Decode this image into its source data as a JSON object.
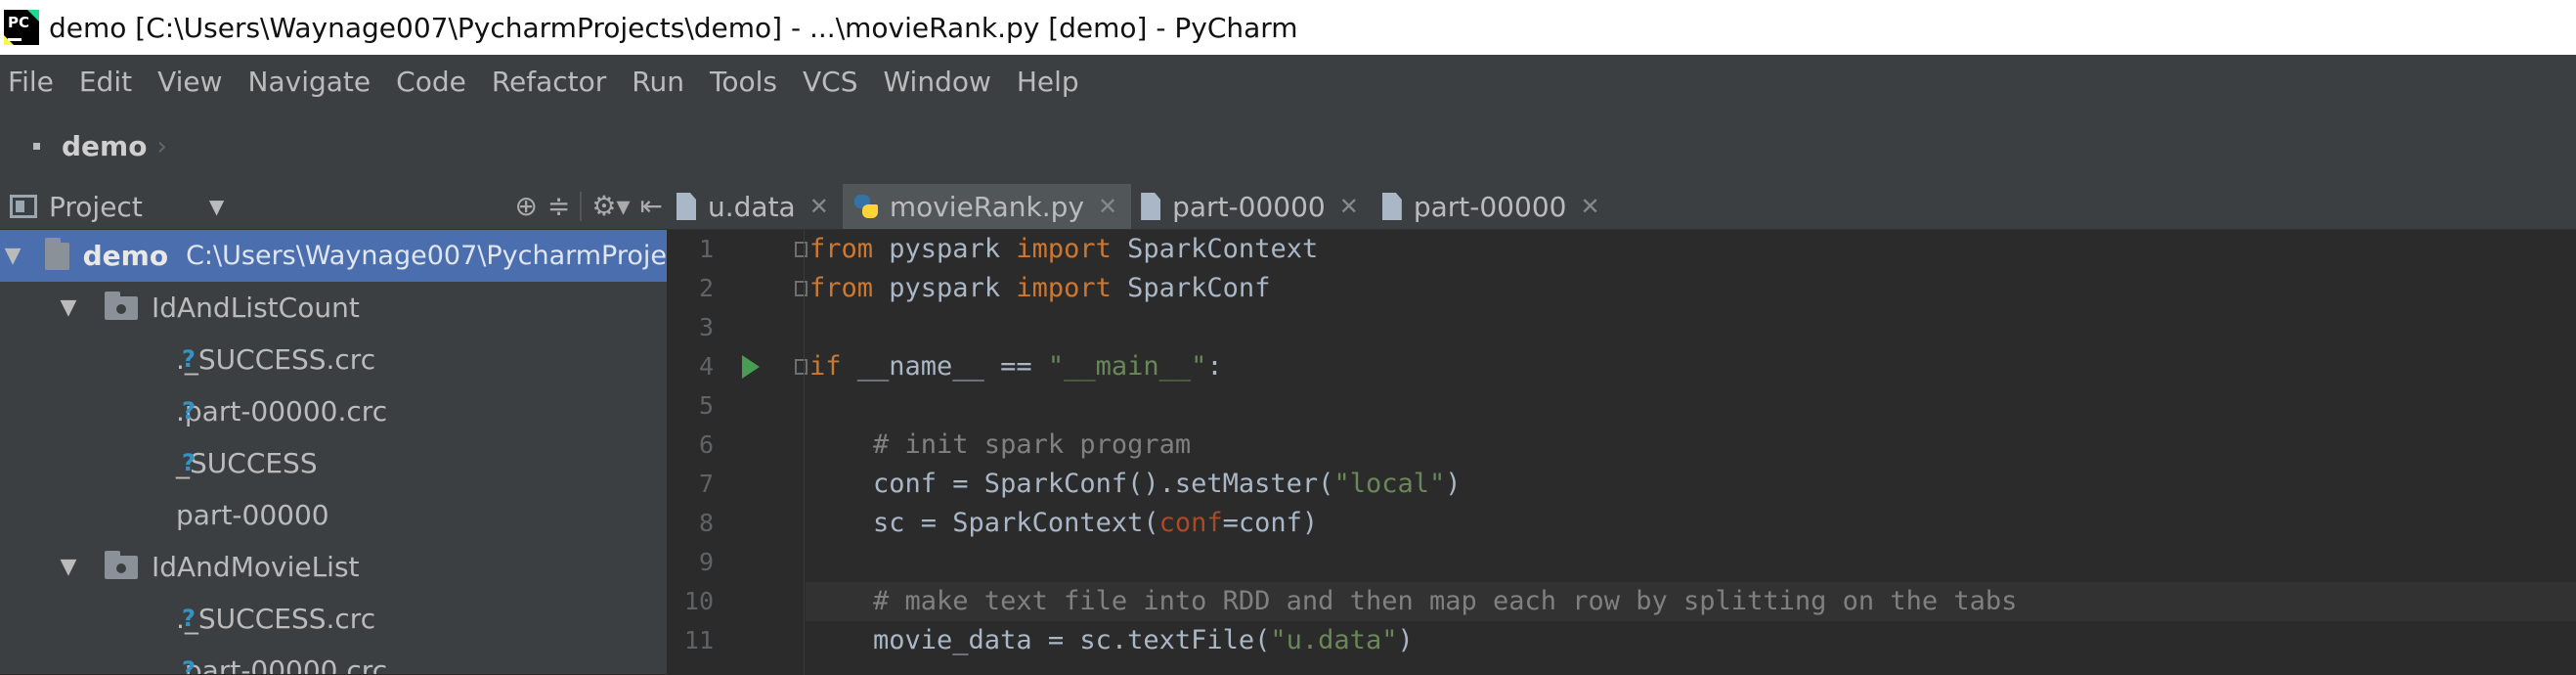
{
  "window": {
    "title": "demo [C:\\Users\\Waynage007\\PycharmProjects\\demo] - ...\\movieRank.py [demo] - PyCharm",
    "app_icon": "pycharm-logo"
  },
  "menu": {
    "items": [
      "File",
      "Edit",
      "View",
      "Navigate",
      "Code",
      "Refactor",
      "Run",
      "Tools",
      "VCS",
      "Window",
      "Help"
    ]
  },
  "navbar": {
    "crumb": "demo"
  },
  "project_panel": {
    "label": "Project",
    "tree": [
      {
        "name": "demo",
        "path": "C:\\Users\\Waynage007\\PycharmProje",
        "type": "root"
      },
      {
        "name": "IdAndListCount",
        "type": "folder"
      },
      {
        "name": "._SUCCESS.crc",
        "type": "unknown-file"
      },
      {
        "name": ".part-00000.crc",
        "type": "unknown-file"
      },
      {
        "name": "_SUCCESS",
        "type": "unknown-file"
      },
      {
        "name": "part-00000",
        "type": "text-file"
      },
      {
        "name": "IdAndMovieList",
        "type": "folder"
      },
      {
        "name": "._SUCCESS.crc",
        "type": "unknown-file"
      },
      {
        "name": ".part-00000.crc",
        "type": "unknown-file"
      }
    ]
  },
  "editor": {
    "tabs": [
      {
        "label": "u.data",
        "icon": "text-file-icon",
        "active": false
      },
      {
        "label": "movieRank.py",
        "icon": "python-file-icon",
        "active": true
      },
      {
        "label": "part-00000",
        "icon": "text-file-icon",
        "active": false
      },
      {
        "label": "part-00000",
        "icon": "text-file-icon",
        "active": false
      }
    ],
    "line_numbers": [
      "1",
      "2",
      "3",
      "4",
      "5",
      "6",
      "7",
      "8",
      "9",
      "10",
      "11"
    ],
    "code": {
      "l1": {
        "kw1": "from",
        "t1": " pyspark ",
        "kw2": "import",
        "t2": " SparkContext"
      },
      "l2": {
        "kw1": "from",
        "t1": " pyspark ",
        "kw2": "import",
        "t2": " SparkConf"
      },
      "l4": {
        "kw1": "if",
        "t1": " __name__ == ",
        "s1": "\"__main__\"",
        "t2": ":"
      },
      "l6": {
        "cm": "    # init spark program"
      },
      "l7": {
        "t1": "    conf = SparkConf().setMaster(",
        "s1": "\"local\"",
        "t2": ")"
      },
      "l8": {
        "t1": "    sc = SparkContext(",
        "p1": "conf",
        "t2": "=conf)"
      },
      "l10": {
        "cm": "    # make text file into RDD and then map each row by splitting on the tabs"
      },
      "l11": {
        "t1": "    movie_data = sc.textFile(",
        "s1": "\"u.data\"",
        "t2": ")"
      }
    }
  }
}
